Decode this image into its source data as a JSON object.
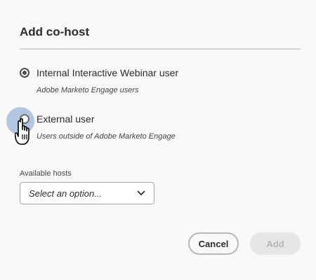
{
  "dialog": {
    "title": "Add co-host",
    "options": [
      {
        "label": "Internal Interactive Webinar user",
        "description": "Adobe Marketo Engage users",
        "selected": true
      },
      {
        "label": "External user",
        "description": "Users outside of Adobe Marketo Engage",
        "selected": false
      }
    ],
    "hosts": {
      "label": "Available hosts",
      "selected_value": "Select an option..."
    },
    "buttons": {
      "cancel": "Cancel",
      "add": "Add"
    }
  },
  "icons": [
    "chevron-down-icon",
    "hand-pointer-cursor-icon"
  ]
}
